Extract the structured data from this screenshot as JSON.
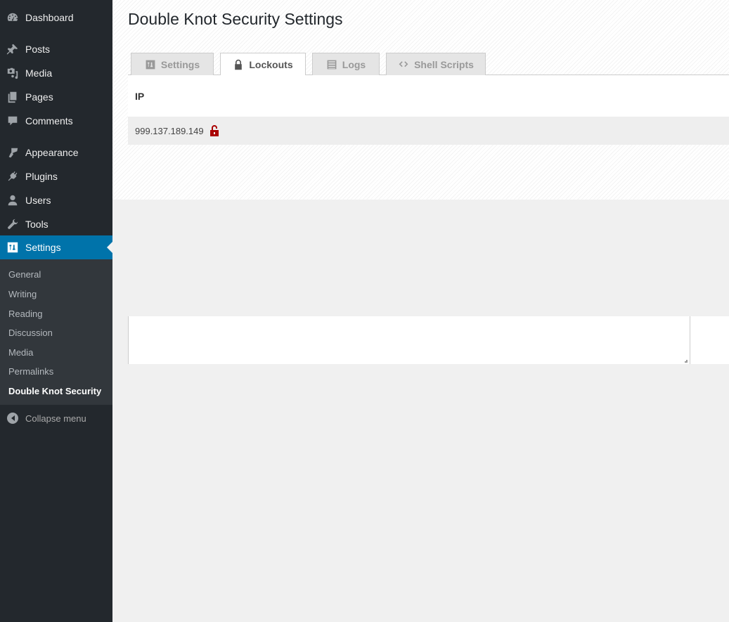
{
  "sidebar": {
    "items": [
      {
        "label": "Dashboard",
        "icon": "dashboard-icon"
      },
      {
        "label": "Posts",
        "icon": "pushpin-icon"
      },
      {
        "label": "Media",
        "icon": "media-icon"
      },
      {
        "label": "Pages",
        "icon": "pages-icon"
      },
      {
        "label": "Comments",
        "icon": "comment-icon"
      },
      {
        "label": "Appearance",
        "icon": "paintbrush-icon"
      },
      {
        "label": "Plugins",
        "icon": "plugin-icon"
      },
      {
        "label": "Users",
        "icon": "user-icon"
      },
      {
        "label": "Tools",
        "icon": "wrench-icon"
      },
      {
        "label": "Settings",
        "icon": "settings-sliders-icon",
        "active": true
      }
    ],
    "submenu": [
      "General",
      "Writing",
      "Reading",
      "Discussion",
      "Media",
      "Permalinks",
      "Double Knot Security"
    ],
    "current_submenu": "Double Knot Security",
    "collapse_label": "Collapse menu"
  },
  "page": {
    "title": "Double Knot Security Settings",
    "tabs": [
      {
        "label": "Settings",
        "icon": "settings-sliders-icon"
      },
      {
        "label": "Lockouts",
        "icon": "lock-icon",
        "active": true
      },
      {
        "label": "Logs",
        "icon": "list-icon"
      },
      {
        "label": "Shell Scripts",
        "icon": "code-icon"
      }
    ],
    "table": {
      "header": "IP",
      "rows": [
        {
          "ip": "999.137.189.149",
          "action_icon": "unlock-icon"
        }
      ]
    },
    "colors": {
      "accent": "#0073aa",
      "unlock": "#aa0000"
    }
  }
}
